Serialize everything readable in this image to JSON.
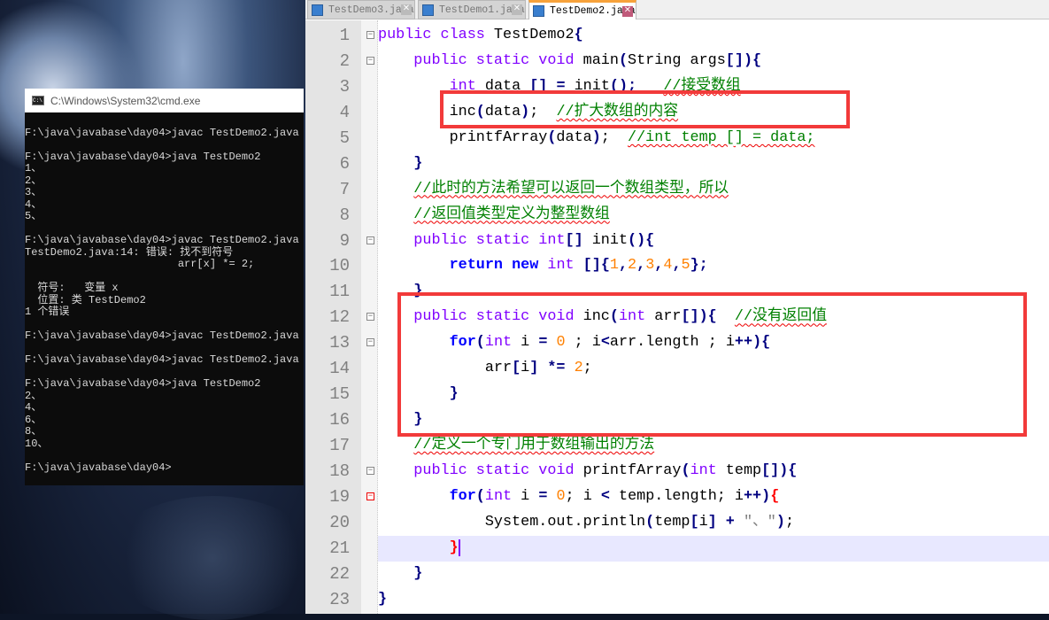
{
  "cmd": {
    "title": "C:\\Windows\\System32\\cmd.exe",
    "lines": [
      "",
      "F:\\java\\javabase\\day04>javac TestDemo2.java",
      "",
      "F:\\java\\javabase\\day04>java TestDemo2",
      "1、",
      "2、",
      "3、",
      "4、",
      "5、",
      "",
      "F:\\java\\javabase\\day04>javac TestDemo2.java",
      "TestDemo2.java:14: 错误: 找不到符号",
      "                        arr[x] *= 2;",
      "",
      "  符号:   变量 x",
      "  位置: 类 TestDemo2",
      "1 个错误",
      "",
      "F:\\java\\javabase\\day04>javac TestDemo2.java",
      "",
      "F:\\java\\javabase\\day04>javac TestDemo2.java",
      "",
      "F:\\java\\javabase\\day04>java TestDemo2",
      "2、",
      "4、",
      "6、",
      "8、",
      "10、",
      "",
      "F:\\java\\javabase\\day04>"
    ]
  },
  "editor": {
    "tabs": [
      {
        "label": "TestDemo3.java",
        "active": false
      },
      {
        "label": "TestDemo1.java",
        "active": false
      },
      {
        "label": "TestDemo2.java",
        "active": true
      }
    ],
    "highlight_line": 21,
    "colors": {
      "keyword": "#8000ff",
      "flow_keyword": "#0000ff",
      "number": "#ff8000",
      "comment": "#008000",
      "operator": "#000080",
      "annotation_box": "#f23a3a"
    },
    "lines": [
      {
        "n": "1",
        "fold": "minus",
        "tokens": [
          [
            "k",
            "public class"
          ],
          [
            "t",
            " TestDemo2"
          ],
          [
            "o",
            "{"
          ]
        ]
      },
      {
        "n": "2",
        "fold": "minus",
        "tokens": [
          [
            "t",
            "    "
          ],
          [
            "k",
            "public static void"
          ],
          [
            "t",
            " main"
          ],
          [
            "o",
            "("
          ],
          [
            "t",
            "String args"
          ],
          [
            "o",
            "[]){"
          ]
        ]
      },
      {
        "n": "3",
        "tokens": [
          [
            "t",
            "        "
          ],
          [
            "k",
            "int"
          ],
          [
            "t",
            " data "
          ],
          [
            "o",
            "[] ="
          ],
          [
            "t",
            " init"
          ],
          [
            "o",
            "();"
          ],
          [
            "t",
            "   "
          ],
          [
            "c",
            "//接受数组"
          ]
        ]
      },
      {
        "n": "4",
        "tokens": [
          [
            "t",
            "        inc"
          ],
          [
            "o",
            "("
          ],
          [
            "t",
            "data"
          ],
          [
            "o",
            ")"
          ],
          [
            "t",
            ";  "
          ],
          [
            "c",
            "//扩大数组的内容"
          ]
        ]
      },
      {
        "n": "5",
        "tokens": [
          [
            "t",
            "        printfArray"
          ],
          [
            "o",
            "("
          ],
          [
            "t",
            "data"
          ],
          [
            "o",
            ")"
          ],
          [
            "t",
            ";  "
          ],
          [
            "c",
            "//int temp [] = data;"
          ]
        ]
      },
      {
        "n": "6",
        "tokens": [
          [
            "t",
            "    "
          ],
          [
            "o",
            "}"
          ]
        ]
      },
      {
        "n": "7",
        "tokens": [
          [
            "t",
            "    "
          ],
          [
            "c",
            "//此时的方法希望可以返回一个数组类型，所以"
          ]
        ]
      },
      {
        "n": "8",
        "tokens": [
          [
            "t",
            "    "
          ],
          [
            "c",
            "//返回值类型定义为整型数组"
          ]
        ]
      },
      {
        "n": "9",
        "fold": "minus",
        "tokens": [
          [
            "t",
            "    "
          ],
          [
            "k",
            "public static int"
          ],
          [
            "o",
            "[]"
          ],
          [
            "t",
            " init"
          ],
          [
            "o",
            "(){"
          ]
        ]
      },
      {
        "n": "10",
        "tokens": [
          [
            "t",
            "        "
          ],
          [
            "b",
            "return new"
          ],
          [
            "t",
            " "
          ],
          [
            "k",
            "int"
          ],
          [
            "t",
            " "
          ],
          [
            "o",
            "[]{"
          ],
          [
            "n",
            "1"
          ],
          [
            "o",
            ","
          ],
          [
            "n",
            "2"
          ],
          [
            "o",
            ","
          ],
          [
            "n",
            "3"
          ],
          [
            "o",
            ","
          ],
          [
            "n",
            "4"
          ],
          [
            "o",
            ","
          ],
          [
            "n",
            "5"
          ],
          [
            "o",
            "};"
          ]
        ]
      },
      {
        "n": "11",
        "tokens": [
          [
            "t",
            "    "
          ],
          [
            "o",
            "}"
          ]
        ]
      },
      {
        "n": "12",
        "fold": "minus",
        "tokens": [
          [
            "t",
            "    "
          ],
          [
            "k",
            "public static void"
          ],
          [
            "t",
            " inc"
          ],
          [
            "o",
            "("
          ],
          [
            "k",
            "int"
          ],
          [
            "t",
            " arr"
          ],
          [
            "o",
            "[]){"
          ],
          [
            "t",
            "  "
          ],
          [
            "c",
            "//没有返回值"
          ]
        ]
      },
      {
        "n": "13",
        "fold": "minus",
        "tokens": [
          [
            "t",
            "        "
          ],
          [
            "b",
            "for"
          ],
          [
            "o",
            "("
          ],
          [
            "k",
            "int"
          ],
          [
            "t",
            " i "
          ],
          [
            "o",
            "="
          ],
          [
            "t",
            " "
          ],
          [
            "n",
            "0"
          ],
          [
            "t",
            " ; i"
          ],
          [
            "o",
            "<"
          ],
          [
            "t",
            "arr.length ; i"
          ],
          [
            "o",
            "++){"
          ]
        ]
      },
      {
        "n": "14",
        "tokens": [
          [
            "t",
            "            arr"
          ],
          [
            "o",
            "["
          ],
          [
            "t",
            "i"
          ],
          [
            "o",
            "] *="
          ],
          [
            "t",
            " "
          ],
          [
            "n",
            "2"
          ],
          [
            "t",
            ";"
          ]
        ]
      },
      {
        "n": "15",
        "tokens": [
          [
            "t",
            "        "
          ],
          [
            "o",
            "}"
          ]
        ]
      },
      {
        "n": "16",
        "tokens": [
          [
            "t",
            "    "
          ],
          [
            "o",
            "}"
          ]
        ]
      },
      {
        "n": "17",
        "tokens": [
          [
            "t",
            "    "
          ],
          [
            "c",
            "//定义一个专门用于数组输出的方法"
          ]
        ]
      },
      {
        "n": "18",
        "fold": "minus",
        "tokens": [
          [
            "t",
            "    "
          ],
          [
            "k",
            "public static void"
          ],
          [
            "t",
            " printfArray"
          ],
          [
            "o",
            "("
          ],
          [
            "k",
            "int"
          ],
          [
            "t",
            " temp"
          ],
          [
            "o",
            "[]){"
          ]
        ]
      },
      {
        "n": "19",
        "fold": "red",
        "tokens": [
          [
            "t",
            "        "
          ],
          [
            "b",
            "for"
          ],
          [
            "o",
            "("
          ],
          [
            "k",
            "int"
          ],
          [
            "t",
            " i "
          ],
          [
            "o",
            "="
          ],
          [
            "t",
            " "
          ],
          [
            "n",
            "0"
          ],
          [
            "t",
            "; i "
          ],
          [
            "o",
            "<"
          ],
          [
            "t",
            " temp.length; i"
          ],
          [
            "o",
            "++)"
          ],
          [
            "r",
            "{"
          ]
        ]
      },
      {
        "n": "20",
        "tokens": [
          [
            "t",
            "            System.out.println"
          ],
          [
            "o",
            "("
          ],
          [
            "t",
            "temp"
          ],
          [
            "o",
            "["
          ],
          [
            "t",
            "i"
          ],
          [
            "o",
            "] +"
          ],
          [
            "t",
            " "
          ],
          [
            "s",
            "\"、\""
          ],
          [
            "o",
            ")"
          ],
          [
            "t",
            ";"
          ]
        ]
      },
      {
        "n": "21",
        "tokens": [
          [
            "t",
            "        "
          ],
          [
            "r",
            "}"
          ]
        ]
      },
      {
        "n": "22",
        "tokens": [
          [
            "t",
            "    "
          ],
          [
            "o",
            "}"
          ]
        ]
      },
      {
        "n": "23",
        "tokens": [
          [
            "o",
            "}"
          ]
        ]
      }
    ]
  }
}
